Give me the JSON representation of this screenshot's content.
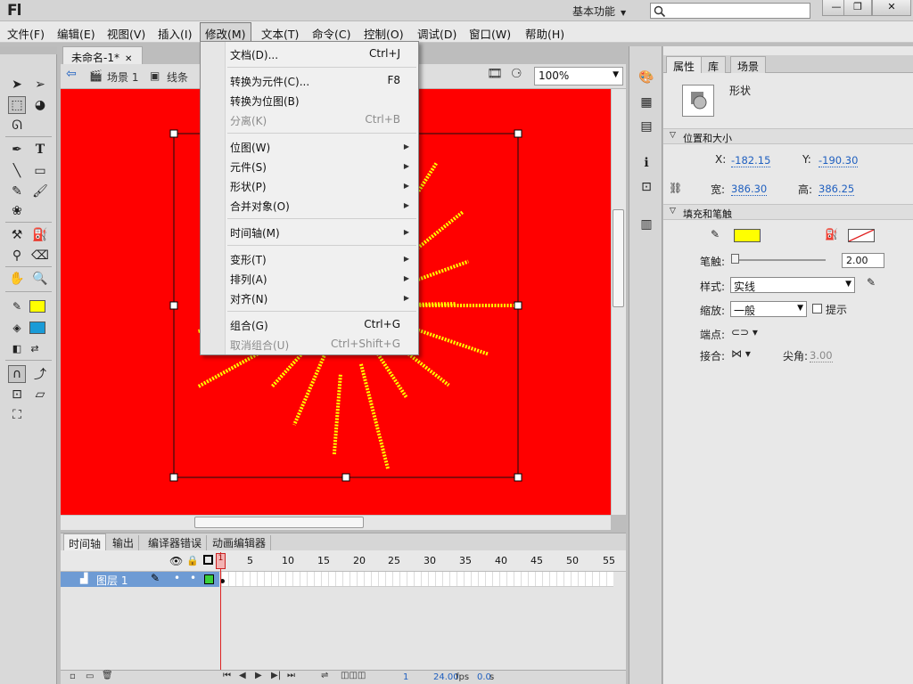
{
  "app": {
    "logo": "Fl",
    "workspace": "基本功能",
    "window_buttons": [
      "—",
      "❐",
      "✕"
    ]
  },
  "menubar": [
    "文件(F)",
    "编辑(E)",
    "视图(V)",
    "插入(I)",
    "修改(M)",
    "文本(T)",
    "命令(C)",
    "控制(O)",
    "调试(D)",
    "窗口(W)",
    "帮助(H)"
  ],
  "doc_tab": "未命名-1*",
  "breadcrumb": {
    "scene": "场景 1",
    "symbol": "线条"
  },
  "zoom": "100%",
  "modify_menu": {
    "items": [
      {
        "label": "文档(D)...",
        "shortcut": "Ctrl+J",
        "disabled": false,
        "submenu": false
      },
      {
        "label": "转换为元件(C)...",
        "shortcut": "F8",
        "disabled": false,
        "submenu": false
      },
      {
        "label": "转换为位图(B)",
        "shortcut": "",
        "disabled": false,
        "submenu": false
      },
      {
        "label": "分离(K)",
        "shortcut": "Ctrl+B",
        "disabled": true,
        "submenu": false
      },
      {
        "label": "位图(W)",
        "shortcut": "",
        "disabled": false,
        "submenu": true
      },
      {
        "label": "元件(S)",
        "shortcut": "",
        "disabled": false,
        "submenu": true
      },
      {
        "label": "形状(P)",
        "shortcut": "",
        "disabled": false,
        "submenu": true
      },
      {
        "label": "合并对象(O)",
        "shortcut": "",
        "disabled": false,
        "submenu": true
      },
      {
        "label": "时间轴(M)",
        "shortcut": "",
        "disabled": false,
        "submenu": true
      },
      {
        "label": "变形(T)",
        "shortcut": "",
        "disabled": false,
        "submenu": true
      },
      {
        "label": "排列(A)",
        "shortcut": "",
        "disabled": false,
        "submenu": true
      },
      {
        "label": "对齐(N)",
        "shortcut": "",
        "disabled": false,
        "submenu": true
      },
      {
        "label": "组合(G)",
        "shortcut": "Ctrl+G",
        "disabled": false,
        "submenu": false
      },
      {
        "label": "取消组合(U)",
        "shortcut": "Ctrl+Shift+G",
        "disabled": true,
        "submenu": false
      }
    ]
  },
  "timeline": {
    "tabs": [
      "时间轴",
      "输出",
      "编译器错误",
      "动画编辑器"
    ],
    "frame_numbers": [
      "1",
      "5",
      "10",
      "15",
      "20",
      "25",
      "30",
      "35",
      "40",
      "45",
      "50",
      "55"
    ],
    "layer_name": "图层 1",
    "current_frame": "1",
    "fps": "24.00",
    "fps_unit": "fps",
    "time": "0.0",
    "time_unit": "s"
  },
  "properties": {
    "tabs": [
      "属性",
      "库",
      "场景"
    ],
    "object_type": "形状",
    "section_position": "位置和大小",
    "x_label": "X:",
    "x": "-182.15",
    "y_label": "Y:",
    "y": "-190.30",
    "w_label": "宽:",
    "w": "386.30",
    "h_label": "高:",
    "h": "386.25",
    "section_fill": "填充和笔触",
    "stroke_label": "笔触:",
    "stroke_value": "2.00",
    "style_label": "样式:",
    "style_value": "实线",
    "scale_label": "缩放:",
    "scale_value": "一般",
    "hint_label": "提示",
    "cap_label": "端点:",
    "join_label": "接合:",
    "miter_label": "尖角:",
    "miter_value": "3.00"
  },
  "colors": {
    "stage": "#ff0000",
    "stroke": "#ffff00",
    "fill_toolbar": "#ffff00",
    "fill2_toolbar": "#1a9bd7",
    "line_stroke": "#ffff00"
  }
}
